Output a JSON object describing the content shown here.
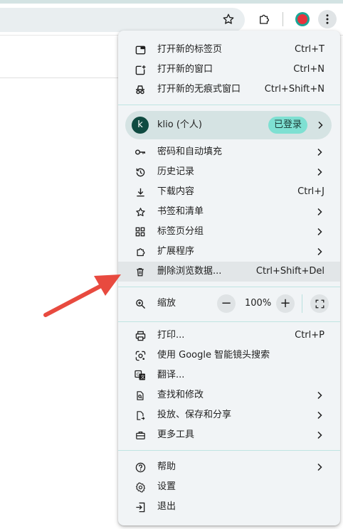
{
  "colors": {
    "accent": "#7ee0d2",
    "menu_bg": "#f1f4f6",
    "profile_bg": "#d5e3e3",
    "arrow": "#e84a3f"
  },
  "toolbar": {
    "icons": [
      "bookmark-star-icon",
      "extensions-icon",
      "profile-indicator-icon",
      "kebab-menu-icon"
    ]
  },
  "menu": {
    "new_tab": {
      "label": "打开新的标签页",
      "shortcut": "Ctrl+T"
    },
    "new_window": {
      "label": "打开新的窗口",
      "shortcut": "Ctrl+N"
    },
    "new_incognito": {
      "label": "打开新的无痕式窗口",
      "shortcut": "Ctrl+Shift+N"
    },
    "profile": {
      "initial": "k",
      "name": "klio (个人)",
      "status": "已登录"
    },
    "passwords": {
      "label": "密码和自动填充"
    },
    "history": {
      "label": "历史记录"
    },
    "downloads": {
      "label": "下载内容",
      "shortcut": "Ctrl+J"
    },
    "bookmarks": {
      "label": "书签和清单"
    },
    "tab_groups": {
      "label": "标签页分组"
    },
    "extensions": {
      "label": "扩展程序"
    },
    "clear_data": {
      "label": "删除浏览数据...",
      "shortcut": "Ctrl+Shift+Del"
    },
    "zoom": {
      "label": "缩放",
      "minus": "−",
      "value": "100%",
      "plus": "+"
    },
    "print": {
      "label": "打印...",
      "shortcut": "Ctrl+P"
    },
    "google_lens": {
      "label": "使用 Google 智能镜头搜索"
    },
    "translate": {
      "label": "翻译..."
    },
    "find_edit": {
      "label": "查找和修改"
    },
    "cast_save_share": {
      "label": "投放、保存和分享"
    },
    "more_tools": {
      "label": "更多工具"
    },
    "help": {
      "label": "帮助"
    },
    "settings": {
      "label": "设置"
    },
    "exit": {
      "label": "退出"
    }
  }
}
